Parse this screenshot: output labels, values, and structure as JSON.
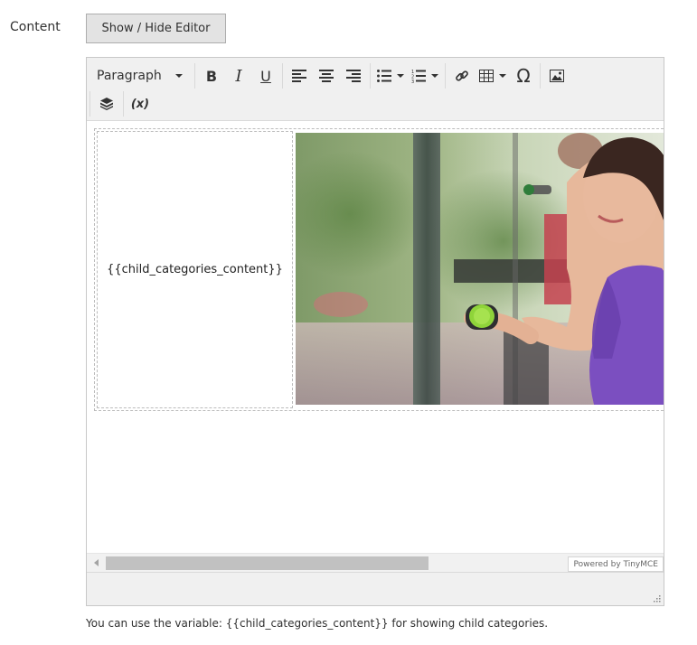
{
  "field": {
    "label": "Content"
  },
  "toggle_button": {
    "label": "Show / Hide Editor"
  },
  "toolbar": {
    "format_select": "Paragraph",
    "bold": "B",
    "italic": "I",
    "underline": "U",
    "special_char": "Ω",
    "variable": "(x)"
  },
  "content": {
    "placeholder_variable": "{{child_categories_content}}"
  },
  "footer": {
    "powered_by": "Powered by TinyMCE"
  },
  "note": {
    "text": "You can use the variable: {{child_categories_content}} for showing child categories."
  },
  "colors": {
    "button_bg": "#e3e3e3",
    "toolbar_bg": "#f0f0f0",
    "tank_top": "#7b4fc0",
    "dumbbell": "#8fd43a"
  },
  "icons": [
    "align-left-icon",
    "align-center-icon",
    "align-right-icon",
    "bullet-list-icon",
    "numbered-list-icon",
    "link-icon",
    "table-icon",
    "image-icon",
    "widget-icon",
    "resize-handle-icon"
  ]
}
